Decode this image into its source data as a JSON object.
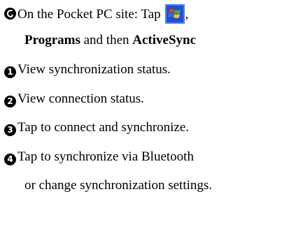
{
  "intro": {
    "prefix": "On the Pocket PC site: Tap",
    "after_icon": ",",
    "icon": "windows-start-icon",
    "programs": "Programs",
    "and_then": " and then ",
    "activesync": "ActiveSync"
  },
  "steps": [
    {
      "marker": "1",
      "text": "View synchronization status."
    },
    {
      "marker": "2",
      "text": "View connection status."
    },
    {
      "marker": "3",
      "text": "Tap to connect and synchronize."
    },
    {
      "marker": "4",
      "text": "Tap to synchronize via Bluetooth"
    }
  ],
  "continuation": "or change synchronization settings.",
  "colors": {
    "text": "#000000",
    "icon_blue": "#1f4fd8",
    "flag_red": "#e8401c",
    "flag_green": "#3bb33b",
    "flag_blue": "#2e6ee8",
    "flag_yellow": "#f6c21a"
  }
}
